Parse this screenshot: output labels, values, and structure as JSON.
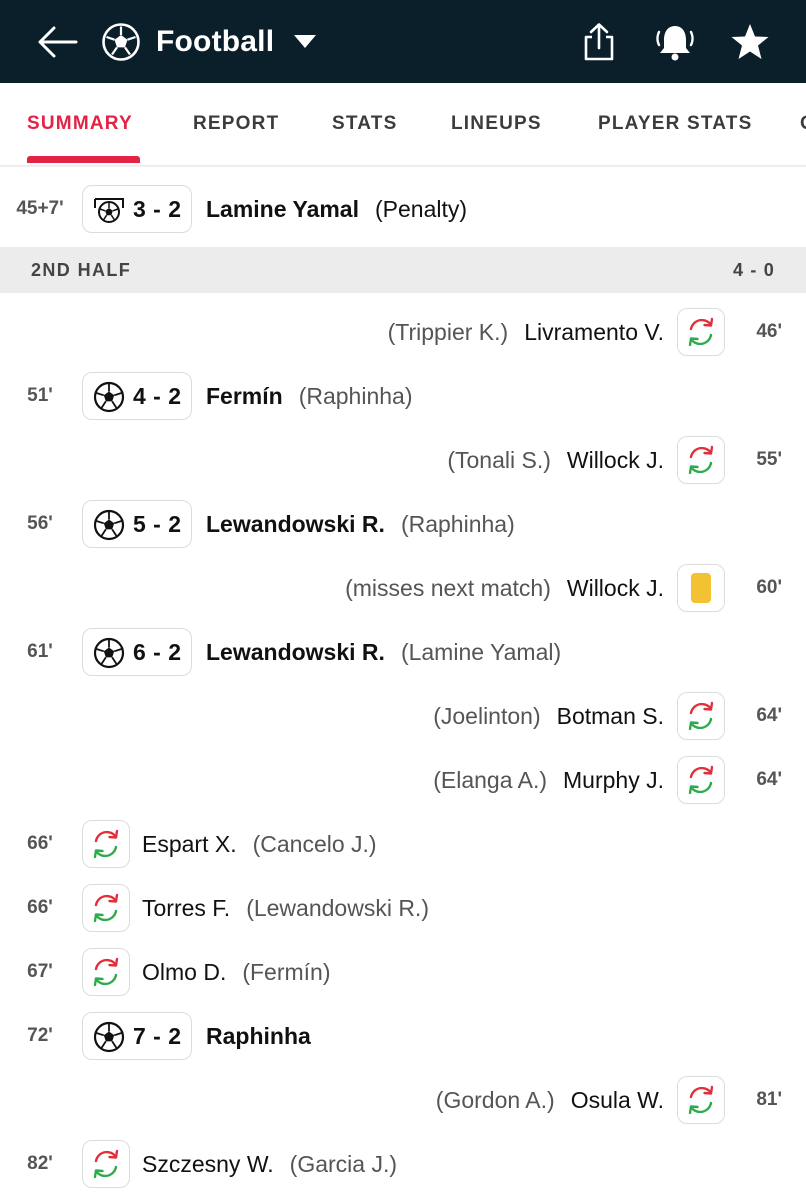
{
  "header": {
    "title": "Football",
    "back_icon": "arrow-left-icon",
    "sport_icon": "soccer-ball-icon",
    "dropdown_icon": "caret-down-icon",
    "share_icon": "share-icon",
    "notify_icon": "bell-ringing-icon",
    "favorite_icon": "star-icon"
  },
  "tabs": [
    {
      "label": "SUMMARY",
      "active": true
    },
    {
      "label": "REPORT"
    },
    {
      "label": "STATS"
    },
    {
      "label": "LINEUPS"
    },
    {
      "label": "PLAYER STATS"
    },
    {
      "label": "O"
    }
  ],
  "colors": {
    "header_bg": "#0b1f2a",
    "accent": "#e32245",
    "yellow_card": "#f2c232",
    "sub_in_green": "#2eaa4a",
    "sub_out_red": "#e0303c"
  },
  "events_top": [
    {
      "minute": "45+7'",
      "type": "penalty-goal",
      "icon": "penalty-goal-icon",
      "score": "3 - 2",
      "player": "Lamine Yamal",
      "note": "(Penalty)"
    }
  ],
  "section": {
    "label": "2ND HALF",
    "score": "4 - 0"
  },
  "events": [
    {
      "minute": "46'",
      "side": "away",
      "type": "substitution",
      "player": "Livramento V.",
      "note": "(Trippier K.)"
    },
    {
      "minute": "51'",
      "side": "home",
      "type": "goal",
      "score": "4 - 2",
      "player": "Fermín",
      "note": "(Raphinha)"
    },
    {
      "minute": "55'",
      "side": "away",
      "type": "substitution",
      "player": "Willock J.",
      "note": "(Tonali S.)"
    },
    {
      "minute": "56'",
      "side": "home",
      "type": "goal",
      "score": "5 - 2",
      "player": "Lewandowski R.",
      "note": "(Raphinha)"
    },
    {
      "minute": "60'",
      "side": "away",
      "type": "yellow-card",
      "player": "Willock J.",
      "note": "(misses next match)"
    },
    {
      "minute": "61'",
      "side": "home",
      "type": "goal",
      "score": "6 - 2",
      "player": "Lewandowski R.",
      "note": "(Lamine Yamal)"
    },
    {
      "minute": "64'",
      "side": "away",
      "type": "substitution",
      "player": "Botman S.",
      "note": "(Joelinton)"
    },
    {
      "minute": "64'",
      "side": "away",
      "type": "substitution",
      "player": "Murphy J.",
      "note": "(Elanga A.)"
    },
    {
      "minute": "66'",
      "side": "home",
      "type": "substitution",
      "player": "Espart X.",
      "note": "(Cancelo J.)"
    },
    {
      "minute": "66'",
      "side": "home",
      "type": "substitution",
      "player": "Torres F.",
      "note": "(Lewandowski R.)"
    },
    {
      "minute": "67'",
      "side": "home",
      "type": "substitution",
      "player": "Olmo D.",
      "note": "(Fermín)"
    },
    {
      "minute": "72'",
      "side": "home",
      "type": "goal",
      "score": "7 - 2",
      "player": "Raphinha",
      "note": ""
    },
    {
      "minute": "81'",
      "side": "away",
      "type": "substitution",
      "player": "Osula W.",
      "note": "(Gordon A.)"
    },
    {
      "minute": "82'",
      "side": "home",
      "type": "substitution",
      "player": "Szczesny W.",
      "note": "(Garcia J.)"
    }
  ]
}
